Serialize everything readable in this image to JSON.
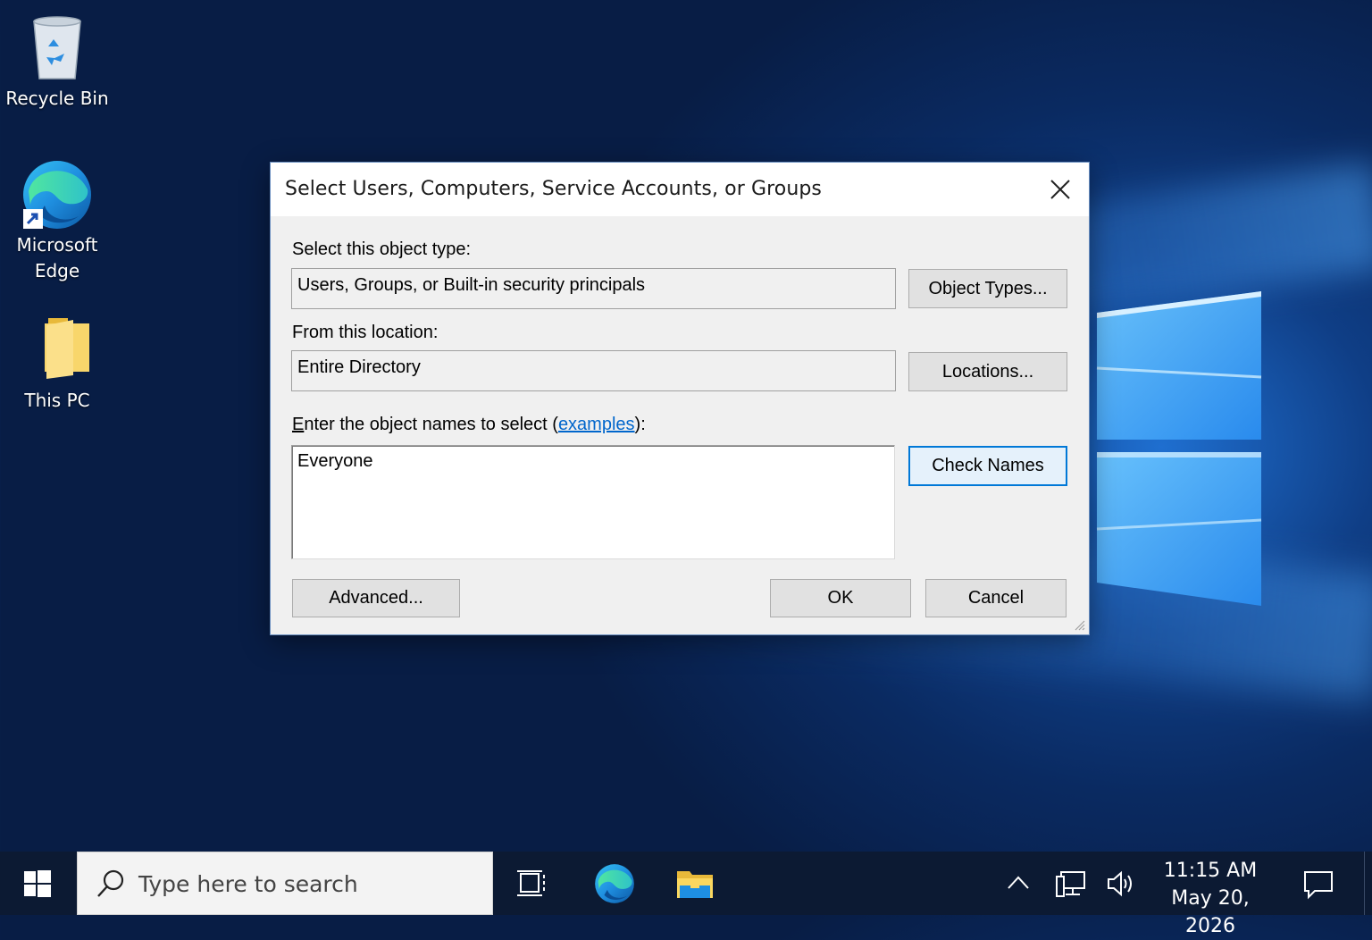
{
  "desktop": {
    "icons": [
      {
        "label": "Recycle Bin",
        "icon": "recycle-bin-icon"
      },
      {
        "label_line1": "Microsoft",
        "label_line2": "Edge",
        "icon": "edge-icon"
      },
      {
        "label": "This PC",
        "icon": "folder-icon"
      }
    ]
  },
  "dialog": {
    "title": "Select Users, Computers, Service Accounts, or Groups",
    "object_type_label": "Select this object type:",
    "object_type_value": "Users, Groups, or Built-in security principals",
    "object_types_button": "Object Types...",
    "location_label": "From this location:",
    "location_value": "Entire Directory",
    "locations_button": "Locations...",
    "names_label_prefix_underlined": "E",
    "names_label_prefix": "nter the object names to select (",
    "names_label_link": "examples",
    "names_label_suffix": "):",
    "names_value": "Everyone",
    "check_names_button": "Check Names",
    "advanced_button": "Advanced...",
    "ok_button": "OK",
    "cancel_button": "Cancel"
  },
  "taskbar": {
    "search_placeholder": "Type here to search",
    "time": "11:15 AM",
    "date": "May 20, 2026"
  },
  "colors": {
    "accent": "#0078d7",
    "link": "#0066cc",
    "taskbar": "#0c1a33"
  }
}
